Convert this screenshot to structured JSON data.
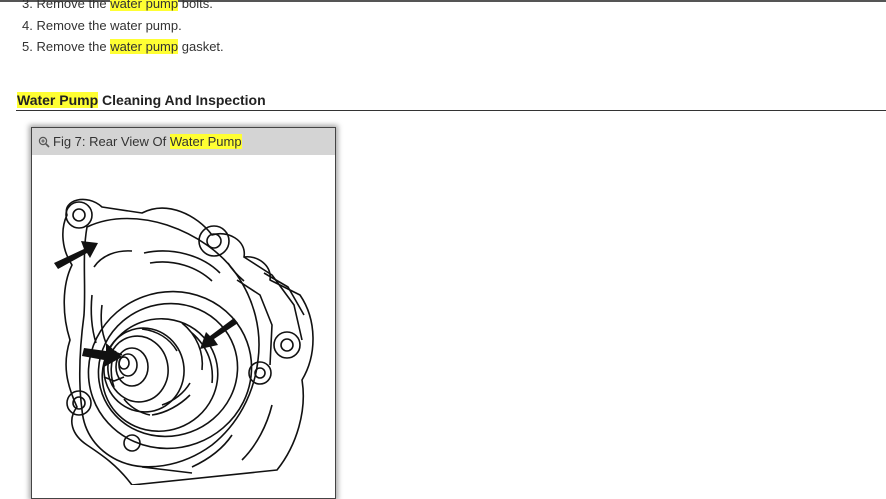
{
  "steps": [
    {
      "num": "3.",
      "before": "Remove the",
      "highlight": "water pump",
      "after": "bolts."
    },
    {
      "num": "4.",
      "before": "Remove the water pump.",
      "highlight": "",
      "after": ""
    },
    {
      "num": "5.",
      "before": "Remove the",
      "highlight": "water pump",
      "after": "gasket."
    }
  ],
  "section": {
    "title_highlight": "Water Pump",
    "title_rest": "Cleaning And Inspection"
  },
  "figure": {
    "caption_prefix": "Fig 7: Rear View Of",
    "caption_highlight": "Water Pump",
    "icon": "zoom-in-icon"
  },
  "colors": {
    "highlight": "#ffff33",
    "caption_bg": "#d4d4d4"
  }
}
